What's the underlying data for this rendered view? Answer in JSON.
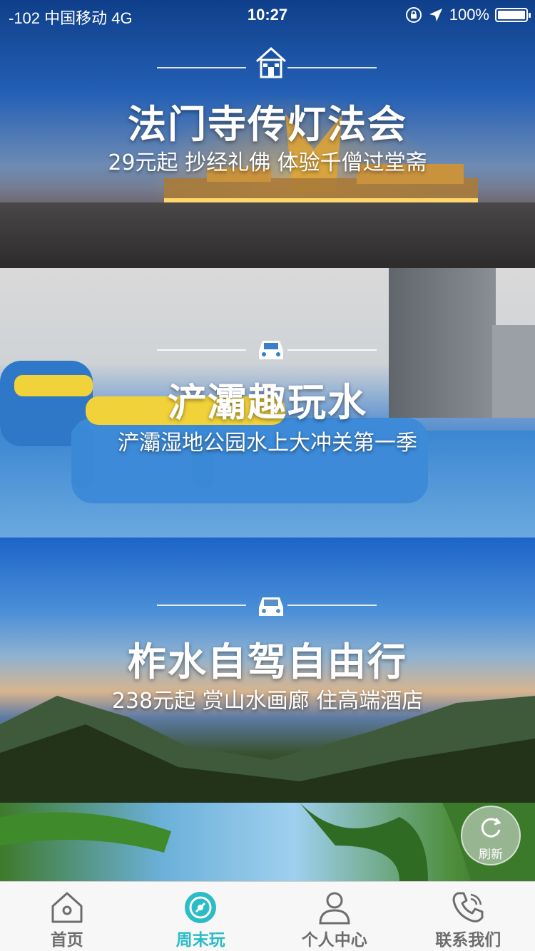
{
  "status_bar": {
    "carrier": "-102 中国移动   4G",
    "time": "10:27",
    "battery": "100%"
  },
  "cards": [
    {
      "title": "法门寺传灯法会",
      "subtitle": "29元起 抄经礼佛 体验千僧过堂斋",
      "icon": "house-icon"
    },
    {
      "title": "浐灞趣玩水",
      "subtitle": "浐灞湿地公园水上大冲关第一季",
      "icon": "car-icon"
    },
    {
      "title": "柞水自驾自由行",
      "subtitle": "238元起 赏山水画廊 住高端酒店",
      "icon": "car-icon"
    }
  ],
  "refresh": {
    "label": "刷新"
  },
  "tabbar": {
    "active_color": "#2cbcc7",
    "items": [
      {
        "label": "首页",
        "icon": "home-icon"
      },
      {
        "label": "周末玩",
        "icon": "compass-icon"
      },
      {
        "label": "个人中心",
        "icon": "person-icon"
      },
      {
        "label": "联系我们",
        "icon": "phone-icon"
      }
    ]
  }
}
